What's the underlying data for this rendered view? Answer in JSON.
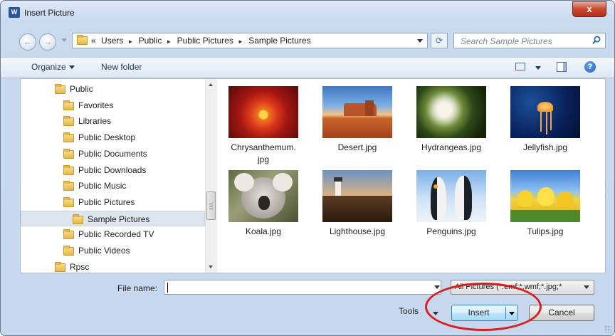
{
  "window": {
    "title": "Insert Picture",
    "app_icon": "word-icon",
    "app_icon_text": "W",
    "close_label": "x"
  },
  "address": {
    "back_icon": "back-arrow-icon",
    "forward_icon": "forward-arrow-icon",
    "overflow": "«",
    "breadcrumbs": [
      "Users",
      "Public",
      "Public Pictures",
      "Sample Pictures"
    ],
    "separator": "►",
    "refresh_icon": "refresh-icon"
  },
  "search": {
    "placeholder": "Search Sample Pictures",
    "icon": "search-icon"
  },
  "toolbar": {
    "organize_label": "Organize",
    "new_folder_label": "New folder",
    "views_icon": "views-icon",
    "preview_icon": "preview-pane-icon",
    "help_icon": "help-icon",
    "help_text": "?"
  },
  "nav_tree": [
    {
      "label": "Public",
      "level": 0,
      "selected": false
    },
    {
      "label": "Favorites",
      "level": 1,
      "selected": false
    },
    {
      "label": "Libraries",
      "level": 1,
      "selected": false
    },
    {
      "label": "Public Desktop",
      "level": 1,
      "selected": false
    },
    {
      "label": "Public Documents",
      "level": 1,
      "selected": false
    },
    {
      "label": "Public Downloads",
      "level": 1,
      "selected": false
    },
    {
      "label": "Public Music",
      "level": 1,
      "selected": false
    },
    {
      "label": "Public Pictures",
      "level": 1,
      "selected": false
    },
    {
      "label": "Sample Pictures",
      "level": 2,
      "selected": true
    },
    {
      "label": "Public Recorded TV",
      "level": 1,
      "selected": false
    },
    {
      "label": "Public Videos",
      "level": 1,
      "selected": false
    },
    {
      "label": "Rpsc",
      "level": 0,
      "selected": false
    }
  ],
  "files": [
    {
      "name": "Chrysanthemum.",
      "name2": "jpg",
      "art": "chrysanthemum"
    },
    {
      "name": "Desert.jpg",
      "art": "desert"
    },
    {
      "name": "Hydrangeas.jpg",
      "art": "hydrangeas"
    },
    {
      "name": "Jellyfish.jpg",
      "art": "jellyfish"
    },
    {
      "name": "Koala.jpg",
      "art": "koala"
    },
    {
      "name": "Lighthouse.jpg",
      "art": "lighthouse"
    },
    {
      "name": "Penguins.jpg",
      "art": "penguins"
    },
    {
      "name": "Tulips.jpg",
      "art": "tulips"
    }
  ],
  "bottom": {
    "file_name_label": "File name:",
    "file_name_value": "",
    "file_type": "All Pictures (*.emf;*.wmf;*.jpg;*",
    "tools_label": "Tools",
    "insert_label": "Insert",
    "cancel_label": "Cancel"
  },
  "colors": {
    "annotation": "#d81e1e",
    "accent": "#3c7fb1"
  }
}
